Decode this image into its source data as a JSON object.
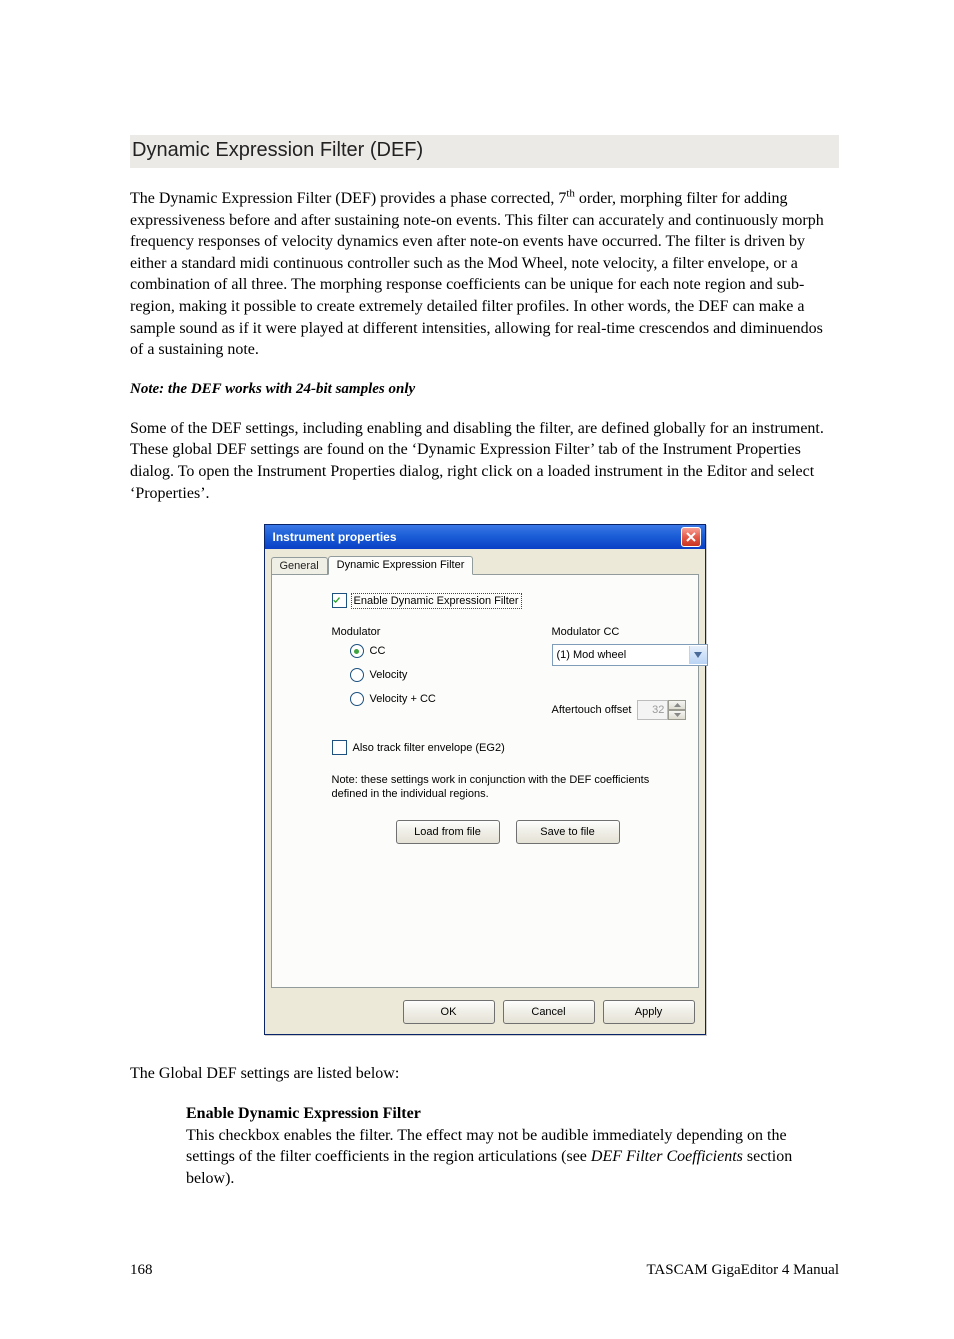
{
  "heading": "Dynamic Expression Filter (DEF)",
  "para1_a": "The Dynamic Expression Filter (DEF) provides a phase corrected, 7",
  "para1_sup": "th",
  "para1_b": " order, morphing filter for adding expressiveness before and after sustaining note-on events.  This filter can accurately and continuously morph frequency responses of velocity dynamics even after note-on events have occurred. The filter is driven by either a standard midi continuous controller such as the Mod Wheel, note velocity, a filter envelope, or a combination of all three.  The morphing response coefficients can be unique for each note region and sub-region, making it possible to create extremely detailed filter profiles. In other words, the DEF can make a sample sound as if it were played at different intensities, allowing for real-time crescendos and diminuendos of a sustaining note.",
  "note_em": "Note: the DEF works with 24-bit samples only",
  "para2": "Some of the DEF settings, including enabling and disabling the filter, are defined globally for an instrument. These global DEF settings are found on the ‘Dynamic Expression Filter’ tab of the Instrument Properties dialog. To open the Instrument Properties dialog, right click on a loaded instrument in the Editor and select ‘Properties’.",
  "dialog": {
    "title": "Instrument properties",
    "tabs": {
      "general": "General",
      "def": "Dynamic Expression Filter"
    },
    "enable_label": "Enable Dynamic Expression Filter",
    "enable_checked": true,
    "modulator_label": "Modulator",
    "radios": {
      "cc": "CC",
      "velocity": "Velocity",
      "velocity_cc": "Velocity + CC"
    },
    "radio_selected": "cc",
    "modulator_cc_label": "Modulator CC",
    "modulator_cc_value": "(1) Mod wheel",
    "aftertouch_label": "Aftertouch offset",
    "aftertouch_value": "32",
    "track_label": "Also track filter envelope (EG2)",
    "track_checked": false,
    "note_text": "Note: these settings work in conjunction with the DEF coefficients defined in the individual regions.",
    "load_btn": "Load from file",
    "save_btn": "Save to file",
    "ok": "OK",
    "cancel": "Cancel",
    "apply_pre": "A",
    "apply_post": "pply"
  },
  "para3": "The Global DEF settings are listed below:",
  "dl": {
    "term": "Enable Dynamic Expression Filter",
    "desc_a": "This checkbox enables the filter.  The effect may not be audible immediately depending on the settings of the filter coefficients in the region articulations (see ",
    "desc_em": "DEF Filter Coefficients",
    "desc_b": " section below)."
  },
  "footer": {
    "page": "168",
    "manual": "TASCAM GigaEditor 4 Manual"
  }
}
